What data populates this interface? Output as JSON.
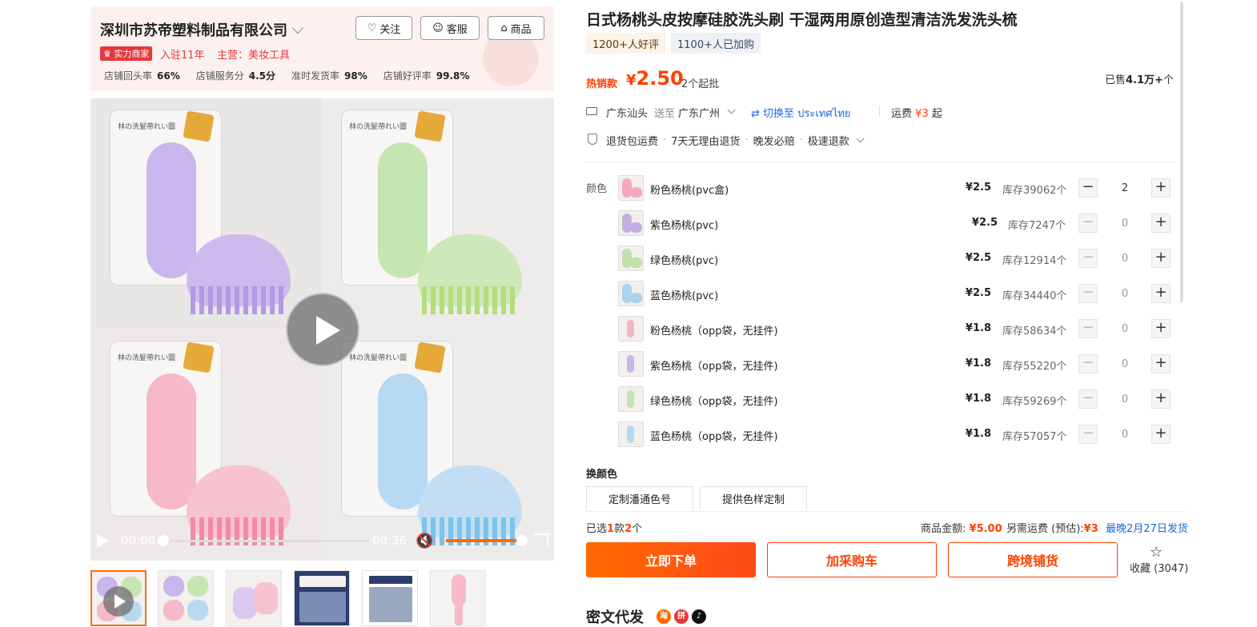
{
  "shop": {
    "name": "深圳市苏帝塑料制品有限公司",
    "follow_label": "关注",
    "service_label": "客服",
    "goods_label": "商品",
    "badge": "实力商家",
    "years": "入驻11年",
    "main_business": "主营：美妆工具",
    "stats": [
      {
        "label": "店铺回头率",
        "value": "66%"
      },
      {
        "label": "店铺服务分",
        "value": "4.5分"
      },
      {
        "label": "准时发货率",
        "value": "98%"
      },
      {
        "label": "店铺好评率",
        "value": "99.8%"
      }
    ]
  },
  "video": {
    "current_time": "00:00",
    "duration": "00:36",
    "progress": 0,
    "volume": 0.9
  },
  "product": {
    "title": "日式杨桃头皮按摩硅胶洗头刷 干湿两用原创造型清洁洗发洗头梳",
    "tags": [
      "1200+人好评",
      "1100+人已加购"
    ],
    "hot_label": "热销款",
    "currency": "¥",
    "price": "2.50",
    "min_batch": "2个起批",
    "sold_prefix": "已售",
    "sold_value": "4.1万+",
    "sold_suffix": "个"
  },
  "shipping": {
    "from": "广东汕头",
    "to_word": "送至",
    "to": "广东广州",
    "switch_label": "切换至 ประเทศไทย",
    "fee_label": "运费",
    "fee_value": "¥3",
    "fee_suffix": "起"
  },
  "guarantees": [
    "退货包运费",
    "7天无理由退货",
    "晚发必赔",
    "极速退款"
  ],
  "color_label": "颜色",
  "skus": [
    {
      "name": "粉色杨桃(pvc盒)",
      "price": "¥2.5",
      "stock": "库存39062个",
      "qty": "2",
      "accent": "#f3a9bd"
    },
    {
      "name": "紫色杨桃(pvc)",
      "price": "¥2.5",
      "stock": "库存7247个",
      "qty": "0",
      "accent": "#c2b0e3"
    },
    {
      "name": "绿色杨桃(pvc)",
      "price": "¥2.5",
      "stock": "库存12914个",
      "qty": "0",
      "accent": "#bfe0a8"
    },
    {
      "name": "蓝色杨桃(pvc)",
      "price": "¥2.5",
      "stock": "库存34440个",
      "qty": "0",
      "accent": "#a9d3ee"
    },
    {
      "name": "粉色杨桃（opp袋，无挂件)",
      "price": "¥1.8",
      "stock": "库存58634个",
      "qty": "0",
      "accent": "#f3b6c5"
    },
    {
      "name": "紫色杨桃（opp袋，无挂件)",
      "price": "¥1.8",
      "stock": "库存55220个",
      "qty": "0",
      "accent": "#c7b7e6"
    },
    {
      "name": "绿色杨桃（opp袋，无挂件)",
      "price": "¥1.8",
      "stock": "库存59269个",
      "qty": "0",
      "accent": "#c4e2b0"
    },
    {
      "name": "蓝色杨桃（opp袋，无挂件)",
      "price": "¥1.8",
      "stock": "库存57057个",
      "qty": "0",
      "accent": "#b5d8ef"
    }
  ],
  "change_color": {
    "label": "换颜色",
    "options": [
      "定制潘通色号",
      "提供色样定制"
    ]
  },
  "selection": {
    "prefix": "已选",
    "kinds": "1",
    "kinds_unit": "款",
    "count": "2",
    "count_unit": "个",
    "amount_label": "商品金额:",
    "amount": "¥5.00",
    "extra_fee_label": "另需运费 (预估):",
    "extra_fee": "¥3",
    "ship_date": "最晚2月27日发货"
  },
  "actions": {
    "order": "立即下单",
    "cart": "加采购车",
    "cross_border": "跨境铺货",
    "favorite": "收藏 (3047)"
  },
  "secret_label": "密文代发",
  "colors": {
    "accent": "#ff4000",
    "brand_orange": "#ff6a00",
    "link_blue": "#1a6adf",
    "purple": "#c9b6ec",
    "green": "#c6e6b1",
    "pink": "#f6b9c9",
    "blue": "#b8d9f2"
  }
}
